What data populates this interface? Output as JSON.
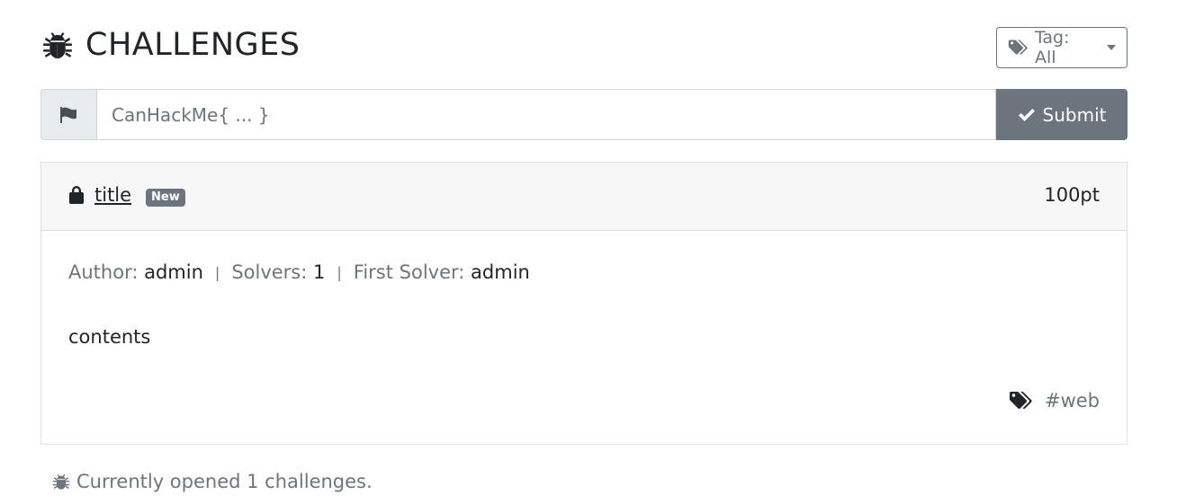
{
  "header": {
    "title": "CHALLENGES",
    "title_icon": "bug-icon",
    "tag_filter_label": "Tag: All",
    "tag_filter_icon": "tags-icon"
  },
  "flag_form": {
    "prepend_icon": "flag-icon",
    "placeholder": "CanHackMe{ ... }",
    "value": "",
    "submit_label": "Submit",
    "submit_icon": "check-icon"
  },
  "challenge": {
    "lock_icon": "lock-icon",
    "title": "title",
    "badge": "New",
    "points": "100pt",
    "author_label": "Author:",
    "author": "admin",
    "solvers_label": "Solvers:",
    "solvers": "1",
    "first_solver_label": "First Solver:",
    "first_solver": "admin",
    "separator": "|",
    "contents": "contents",
    "tag": "#web"
  },
  "footer": {
    "message": "Currently opened 1 challenges."
  },
  "colors": {
    "secondary": "#6c757d",
    "text": "#212529",
    "card_header_bg": "#f7f7f7",
    "input_addon_bg": "#e9ecef",
    "border": "#dee2e6"
  }
}
